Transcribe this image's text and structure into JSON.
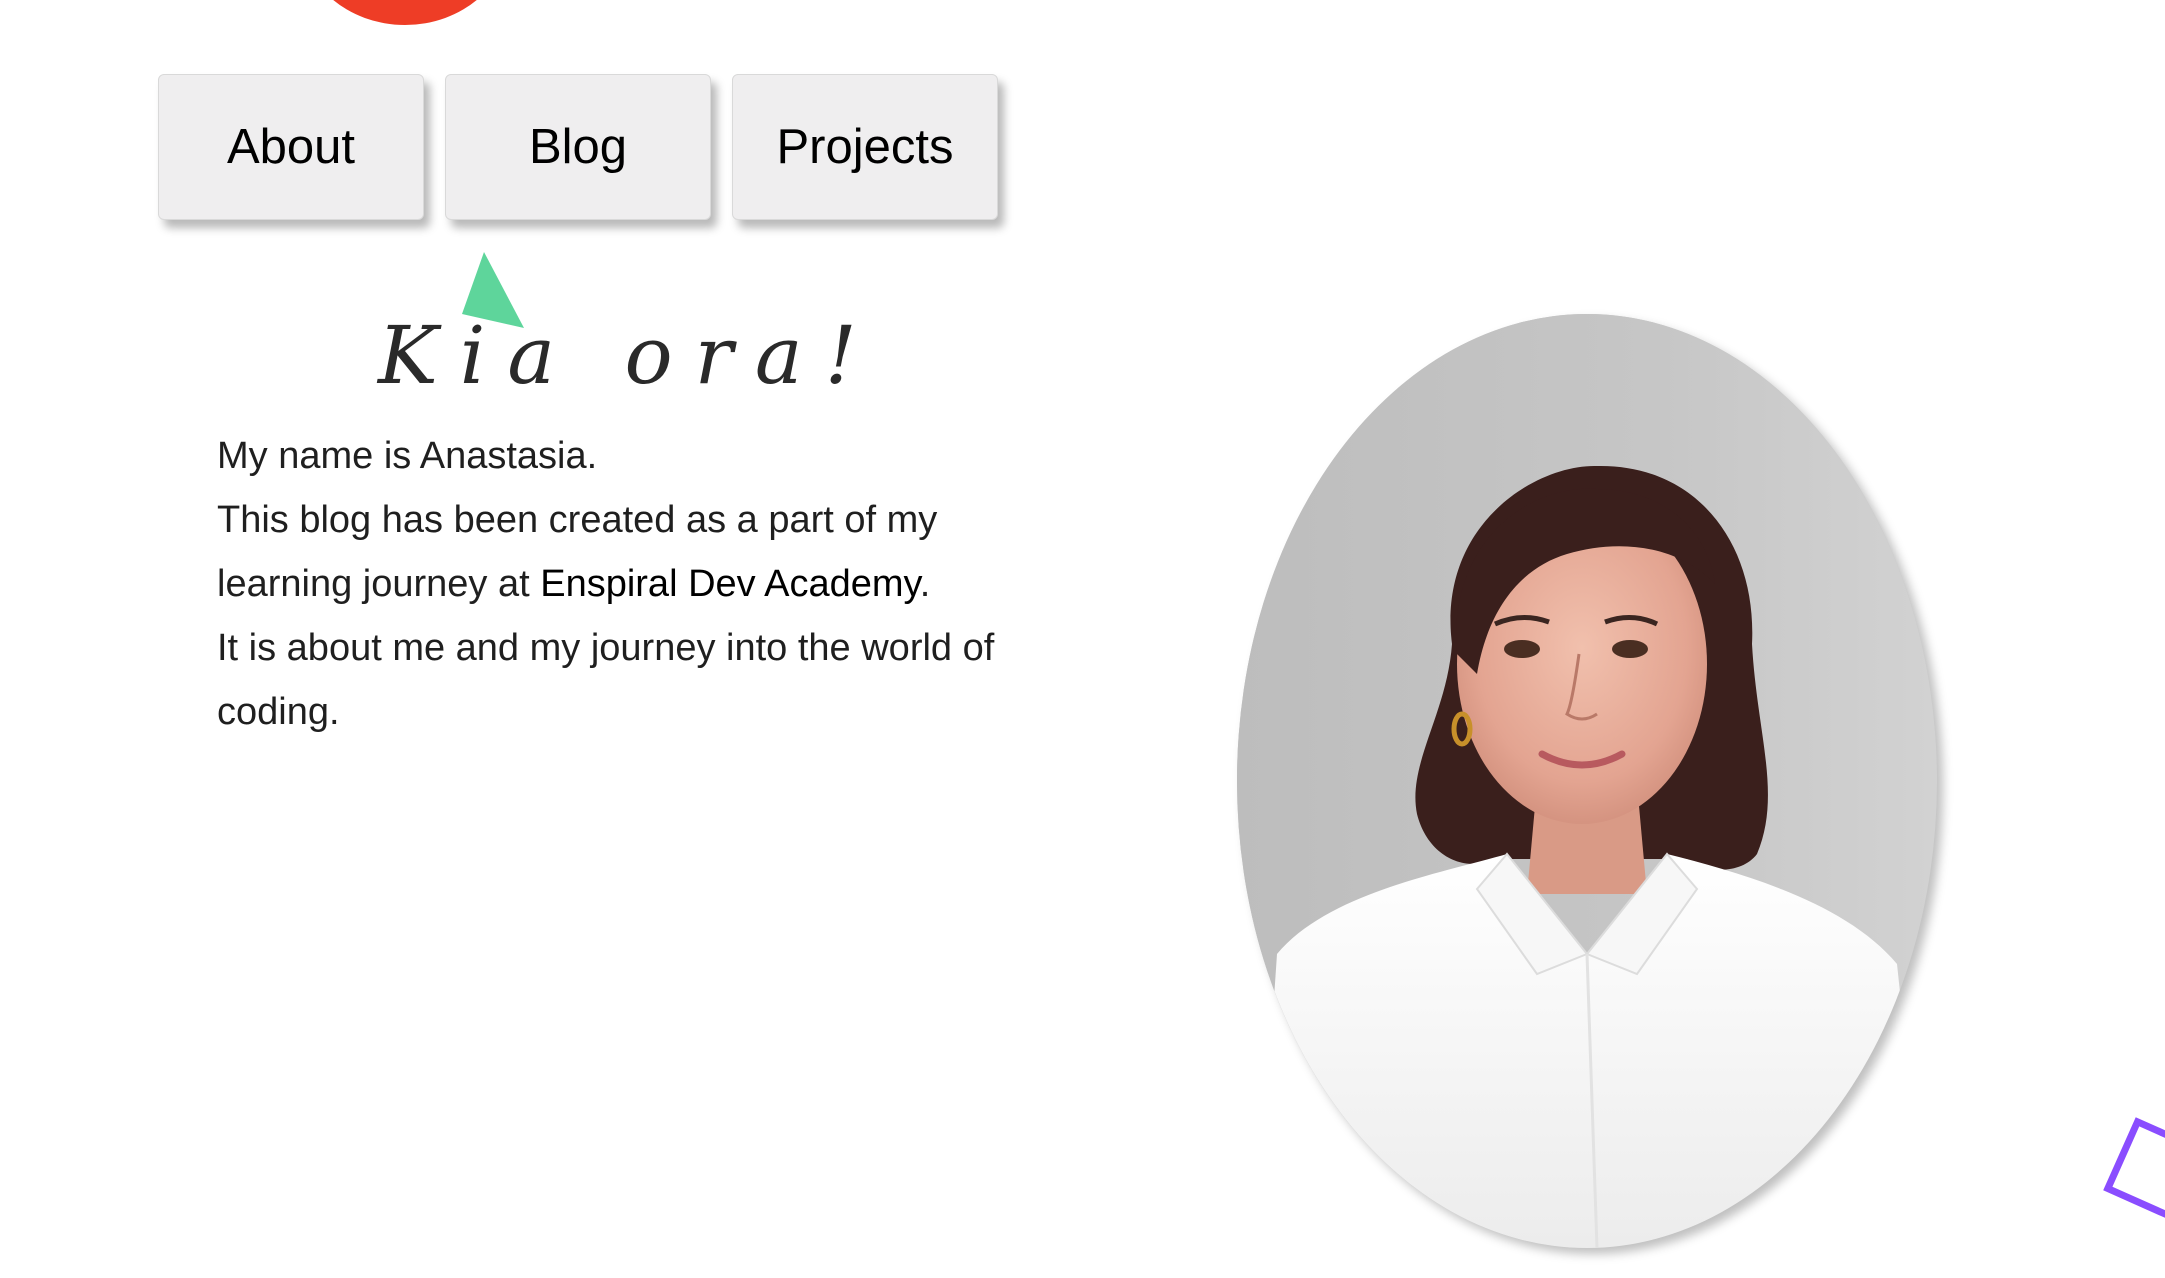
{
  "nav": {
    "items": [
      {
        "label": "About"
      },
      {
        "label": "Blog"
      },
      {
        "label": "Projects"
      }
    ]
  },
  "greeting": "Kia ora!",
  "intro": {
    "line1": "My name is Anastasia.",
    "line2_prefix": "This blog has been created as a part of my learning journey at ",
    "link_text": "Enspiral Dev Academy",
    "line2_suffix": ".",
    "line3": "It is about me and my journey into the world of coding."
  },
  "colors": {
    "circle": "#ee3d26",
    "triangle": "#5ed59b",
    "square": "#8a4dff"
  }
}
